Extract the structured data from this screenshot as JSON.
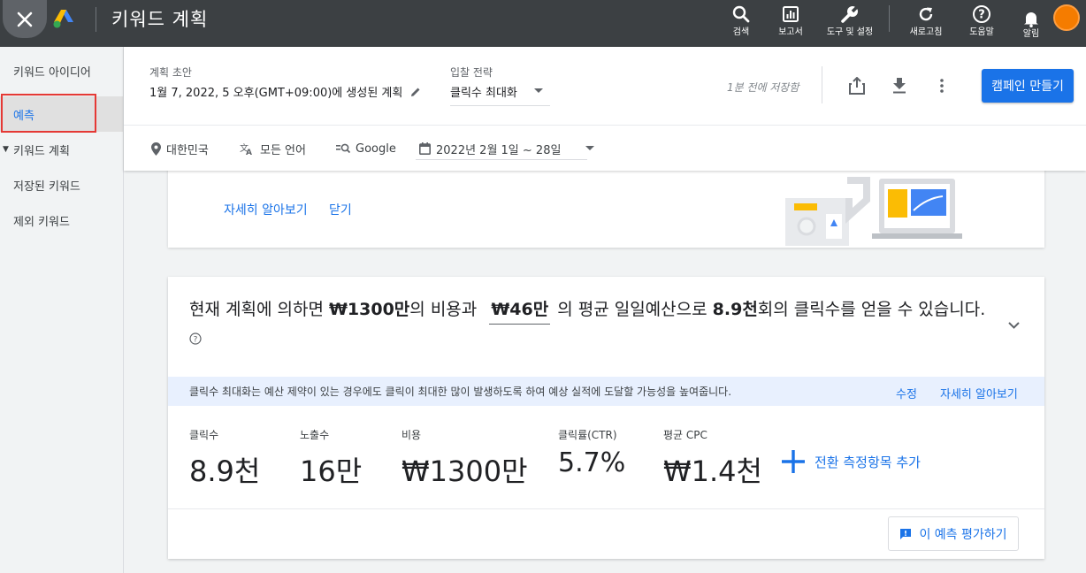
{
  "topbar": {
    "app_title": "키워드 계획",
    "actions": [
      {
        "label": "검색",
        "icon": "search-icon"
      },
      {
        "label": "보고서",
        "icon": "reports-icon"
      },
      {
        "label": "도구 및 설정",
        "icon": "wrench-icon"
      },
      {
        "label": "새로고침",
        "icon": "refresh-icon"
      },
      {
        "label": "도움말",
        "icon": "help-icon"
      },
      {
        "label": "알림",
        "icon": "bell-icon"
      }
    ]
  },
  "sidebar": {
    "items": [
      {
        "label": "키워드 아이디어"
      },
      {
        "label": "예측"
      },
      {
        "label": "키워드 계획"
      },
      {
        "label": "저장된 키워드"
      },
      {
        "label": "제외 키워드"
      }
    ]
  },
  "header": {
    "plan_label": "계획 초안",
    "plan_value": "1월 7, 2022, 5 오후(GMT+09:00)에 생성된 계획",
    "bid_label": "입찰 전략",
    "bid_value": "클릭수 최대화",
    "saved_text": "1분 전에 저장함",
    "create_button": "캠페인 만들기",
    "filters": {
      "location": "대한민국",
      "language": "모든 언어",
      "network": "Google",
      "date_range": "2022년 2월 1일 ~ 28일"
    }
  },
  "info_card": {
    "learn_more": "자세히 알아보기",
    "close": "닫기"
  },
  "forecast": {
    "headline_part1": "현재 계획에 의하면 ",
    "cost": "₩1300만",
    "headline_part2": "의 비용과",
    "budget": "₩46만",
    "headline_part3": "의 평균 일일예산으로 ",
    "clicks": "8.9천",
    "headline_part4": "회의 클릭수를 얻을 수 있습니다.",
    "banner_text": "클릭수 최대화는 예산 제약이 있는 경우에도 클릭이 최대한 많이 발생하도록 하여 예상 실적에 도달할 가능성을 높여줍니다.",
    "banner_edit": "수정",
    "banner_learn_more": "자세히 알아보기",
    "metrics": [
      {
        "label": "클릭수",
        "value": "8.9천"
      },
      {
        "label": "노출수",
        "value": "16만"
      },
      {
        "label": "비용",
        "value": "₩1300만"
      },
      {
        "label": "클릭률(CTR)",
        "value": "5.7%"
      },
      {
        "label": "평균 CPC",
        "value": "₩1.4천"
      }
    ],
    "add_conversion": "전환 측정항목 추가",
    "rate_button": "이 예측 평가하기"
  },
  "colors": {
    "accent": "#1a73e8",
    "topbar": "#3c4043",
    "highlight_border": "#e53935",
    "avatar": "#f57c00"
  }
}
